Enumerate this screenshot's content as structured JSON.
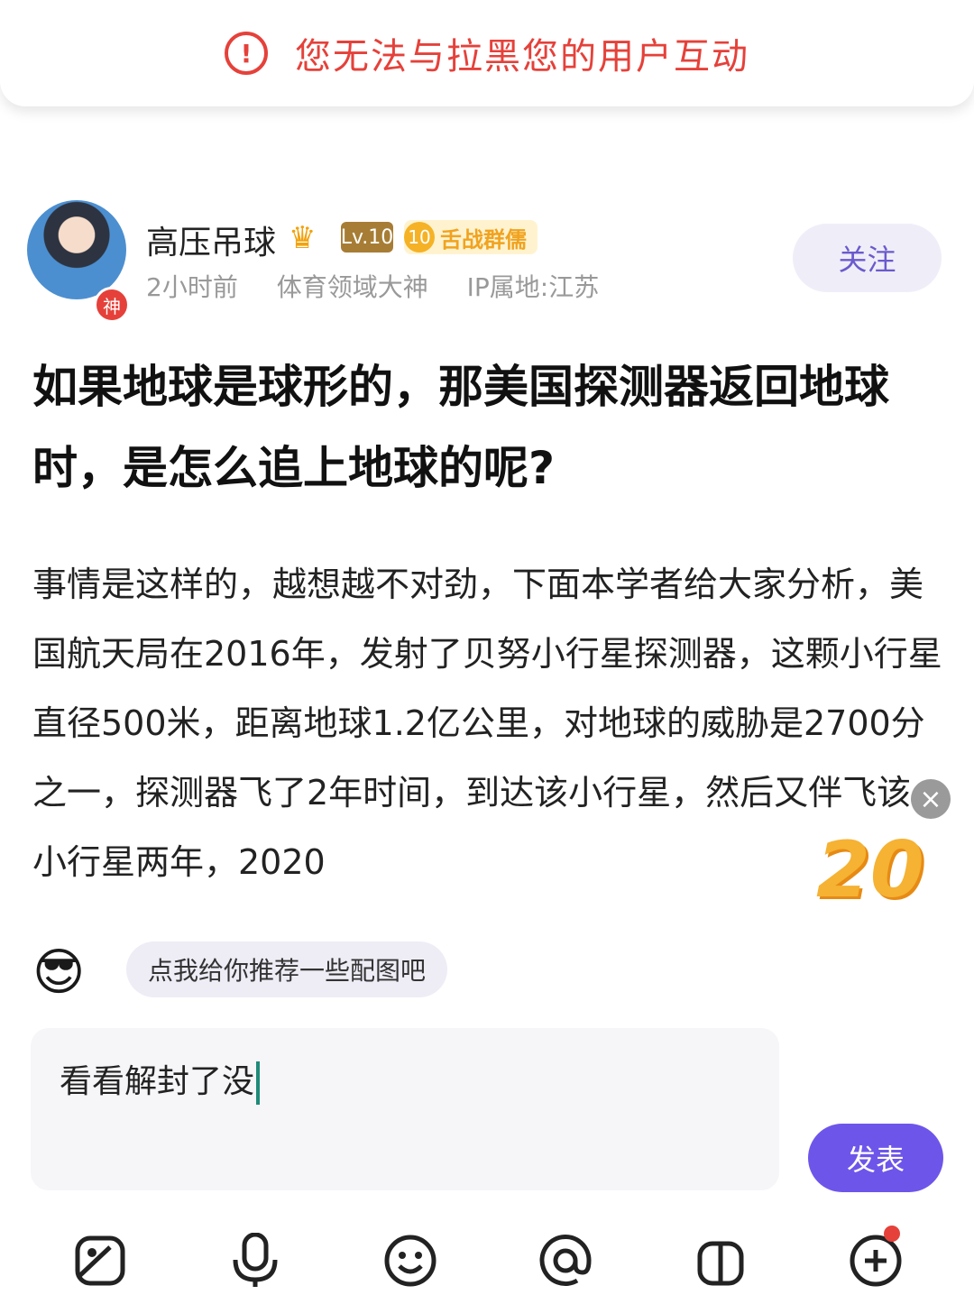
{
  "toast": {
    "icon": "alert-circle-icon",
    "text": "您无法与拉黑您的用户互动"
  },
  "author": {
    "name": "高压吊球",
    "avatar_badge": "神",
    "level": "Lv.10",
    "title_badge_num": "10",
    "title_badge_text": "舌战群儒",
    "time": "2小时前",
    "role": "体育领域大神",
    "ip": "IP属地:江苏",
    "follow_label": "关注"
  },
  "post": {
    "title": "如果地球是球形的，那美国探测器返回地球时，是怎么追上地球的呢?",
    "body": "事情是这样的，越想越不对劲，下面本学者给大家分析，美国航天局在2016年，发射了贝努小行星探测器，这颗小行星直径500米，距离地球1.2亿公里，对地球的威胁是2700分之一，探测器飞了2年时间，到达该小行星，然后又伴飞该小行星两年，2020"
  },
  "floating": {
    "close_icon": "×",
    "badge_text": "20"
  },
  "composer": {
    "suggest_text": "点我给你推荐一些配图吧",
    "input_value": "看看解封了没",
    "send_label": "发表"
  },
  "toolbar": {
    "icons": [
      "image-icon",
      "microphone-icon",
      "emoji-icon",
      "at-icon",
      "gift-icon",
      "add-icon"
    ]
  }
}
